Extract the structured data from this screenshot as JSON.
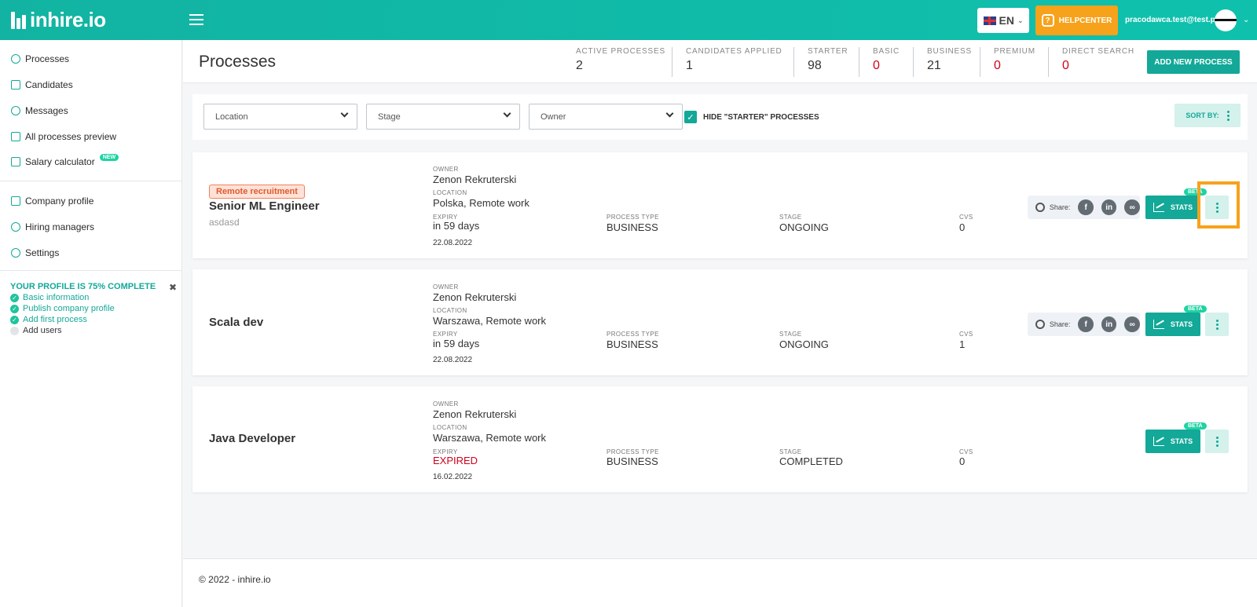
{
  "brand": {
    "name": "inhire.io"
  },
  "topbar": {
    "lang": "EN",
    "help_label": "HELPCENTER",
    "user_email": "pracodawca.test@test.pl"
  },
  "sidebar": {
    "items": [
      {
        "label": "Processes"
      },
      {
        "label": "Candidates"
      },
      {
        "label": "Messages"
      },
      {
        "label": "All processes preview"
      },
      {
        "label": "Salary calculator",
        "badge": "NEW"
      },
      {
        "label": "Company profile"
      },
      {
        "label": "Hiring managers"
      },
      {
        "label": "Settings"
      }
    ],
    "profile": {
      "title": "YOUR PROFILE IS 75% COMPLETE",
      "close": "✖",
      "steps": [
        {
          "label": "Basic information",
          "done": true
        },
        {
          "label": "Publish company profile",
          "done": true
        },
        {
          "label": "Add first process",
          "done": true
        },
        {
          "label": "Add users",
          "done": false
        }
      ]
    }
  },
  "header": {
    "title": "Processes",
    "stats": [
      {
        "label": "ACTIVE PROCESSES",
        "value": "2"
      },
      {
        "label": "CANDIDATES APPLIED",
        "value": "1"
      },
      {
        "label": "STARTER",
        "value": "98"
      },
      {
        "label": "BASIC",
        "value": "0"
      },
      {
        "label": "BUSINESS",
        "value": "21"
      },
      {
        "label": "PREMIUM",
        "value": "0"
      },
      {
        "label": "DIRECT SEARCH",
        "value": "0"
      }
    ],
    "add_label": "ADD NEW PROCESS"
  },
  "filters": {
    "location": "Location",
    "stage": "Stage",
    "owner": "Owner",
    "hide_label": "HIDE \"STARTER\" PROCESSES",
    "sort_label": "SORT BY:"
  },
  "labels": {
    "owner": "OWNER",
    "location": "LOCATION",
    "expiry": "EXPIRY",
    "process_type": "PROCESS TYPE",
    "stage": "STAGE",
    "cvs": "CVS",
    "share": "Share:",
    "stats": "STATS",
    "beta": "BETA"
  },
  "processes": [
    {
      "badge": "Remote recruitment",
      "title": "Senior ML Engineer",
      "subtitle": "asdasd",
      "owner": "Zenon Rekruterski",
      "location": "Polska, Remote work",
      "expiry": "in 59 days",
      "date": "22.08.2022",
      "process_type": "BUSINESS",
      "stage": "ONGOING",
      "cvs": "0"
    },
    {
      "title": "Scala dev",
      "owner": "Zenon Rekruterski",
      "location": "Warszawa, Remote work",
      "expiry": "in 59 days",
      "date": "22.08.2022",
      "process_type": "BUSINESS",
      "stage": "ONGOING",
      "cvs": "1"
    },
    {
      "title": "Java Developer",
      "owner": "Zenon Rekruterski",
      "location": "Warszawa, Remote work",
      "expiry": "EXPIRED",
      "date": "16.02.2022",
      "process_type": "BUSINESS",
      "stage": "COMPLETED",
      "cvs": "0"
    }
  ],
  "footer": {
    "text": "© 2022 - inhire.io"
  },
  "colors": {
    "brand": "#13a898",
    "accent": "#f7a21b",
    "danger": "#d0021b"
  }
}
